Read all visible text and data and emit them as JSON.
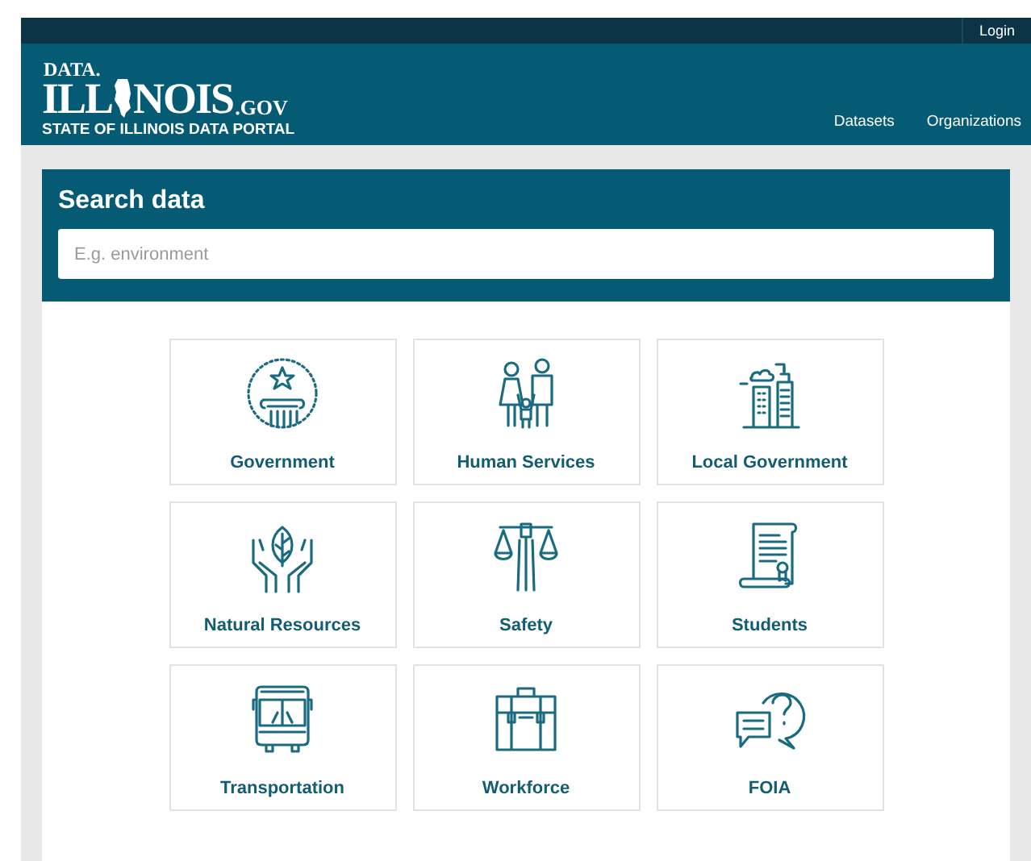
{
  "top_bar": {
    "login": "Login"
  },
  "header": {
    "logo_top": "DATA.",
    "logo_left": "ILL",
    "logo_right": "NOIS",
    "logo_suffix": ".GOV",
    "logo_subtitle": "STATE OF ILLINOIS DATA PORTAL",
    "nav": [
      "Datasets",
      "Organizations"
    ]
  },
  "search": {
    "title": "Search data",
    "placeholder": "E.g. environment"
  },
  "categories": [
    {
      "label": "Government"
    },
    {
      "label": "Human Services"
    },
    {
      "label": "Local Government"
    },
    {
      "label": "Natural Resources"
    },
    {
      "label": "Safety"
    },
    {
      "label": "Students"
    },
    {
      "label": "Transportation"
    },
    {
      "label": "Workforce"
    },
    {
      "label": "FOIA"
    }
  ]
}
